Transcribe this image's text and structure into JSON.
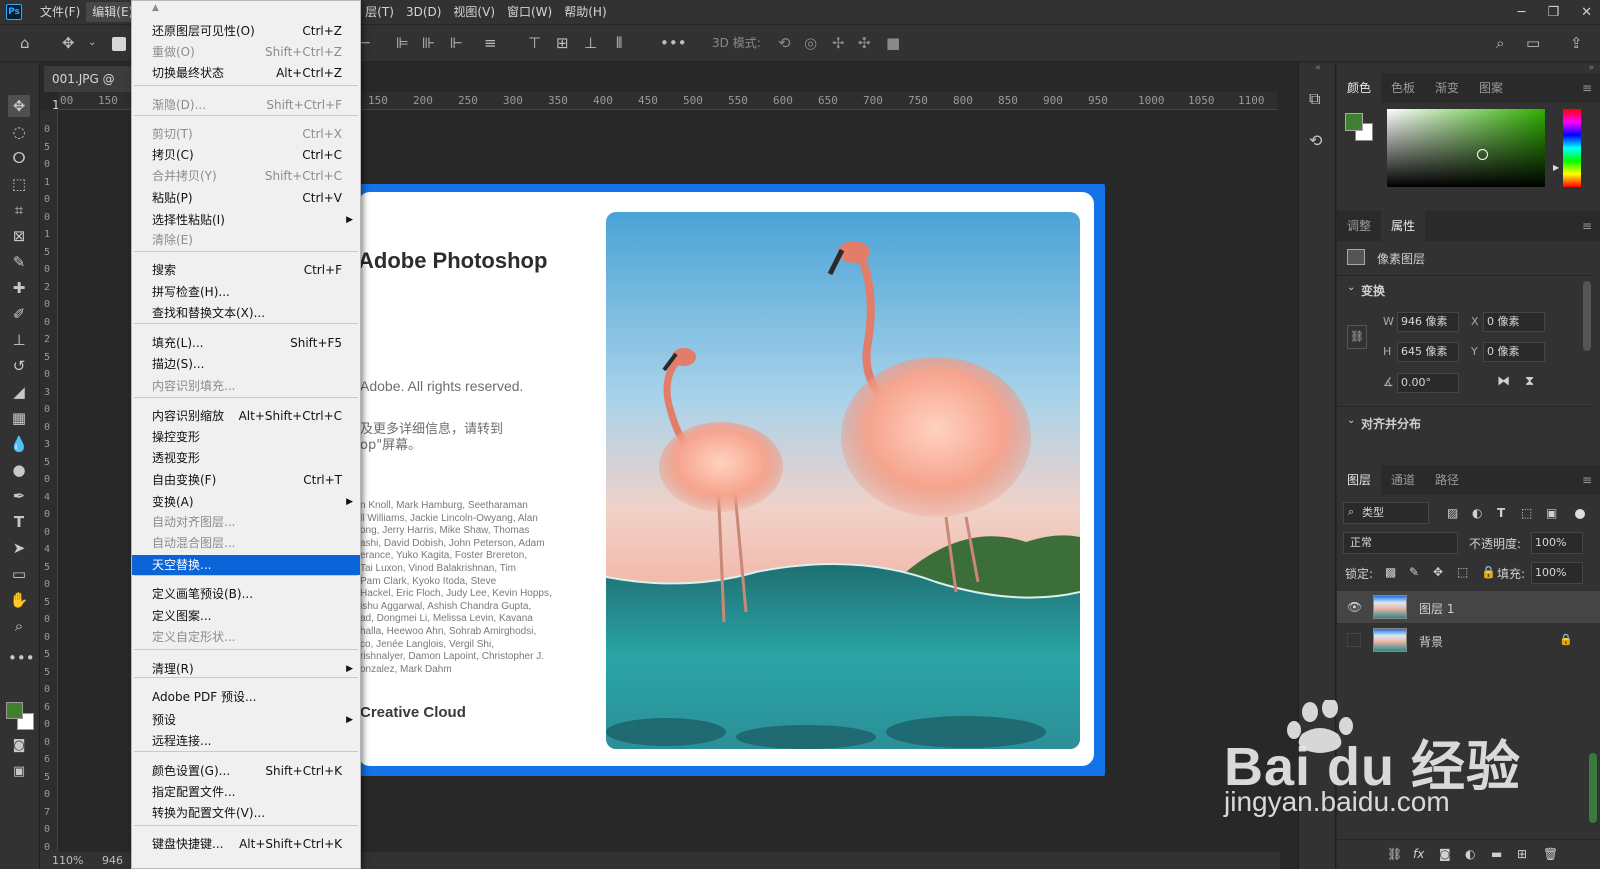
{
  "menubar": {
    "logo": "Ps",
    "items": [
      "文件(F)",
      "编辑(E)",
      "",
      "",
      "",
      "层(T)",
      "3D(D)",
      "视图(V)",
      "窗口(W)",
      "帮助(H)"
    ],
    "active_index": 1
  },
  "options_bar": {
    "mode_label": "3D 模式:"
  },
  "document": {
    "tab_title": "001.JPG @ 110",
    "zoom": "110%",
    "size_fragment": "946",
    "ruler_top": [
      "00",
      "150",
      "150",
      "200",
      "250",
      "300",
      "350",
      "400",
      "450",
      "500",
      "550",
      "600",
      "650",
      "700",
      "750",
      "800",
      "850",
      "900",
      "950",
      "1000",
      "1050",
      "1100"
    ],
    "ruler_left": [
      "0",
      "5",
      "0",
      "1",
      "0",
      "0",
      "1",
      "5",
      "0",
      "2",
      "0",
      "0",
      "2",
      "5",
      "0",
      "3",
      "0",
      "0",
      "3",
      "5",
      "0",
      "4",
      "0",
      "0",
      "4",
      "5",
      "0",
      "5",
      "0",
      "0",
      "5",
      "5",
      "0",
      "6",
      "0",
      "0",
      "6",
      "5",
      "0",
      "7",
      "0",
      "0"
    ]
  },
  "splash": {
    "title": "Adobe Photoshop",
    "copyright": "Adobe. All rights reserved.",
    "more_info_1": "及更多详细信息，请转到",
    "more_info_2": "op\"屏幕。",
    "credits": [
      "n Knoll, Mark Hamburg, Seetharaman",
      "ll Williams, Jackie Lincoln-Owyang, Alan",
      "ong, Jerry Harris, Mike Shaw, Thomas",
      "ashi, David Dobish, John Peterson, Adam",
      "erance, Yuko Kagita, Foster Brereton,",
      "Tai Luxon, Vinod Balakrishnan, Tim",
      "Pam Clark, Kyoko Itoda, Steve",
      "Hackel, Eric Floch, Judy Lee, Kevin Hopps,",
      "ishu Aggarwal, Ashish Chandra Gupta,",
      "ad, Dongmei Li, Melissa Levin, Kavana",
      "halla, Heewoo Ahn, Sohrab Amirghodsi,",
      "co, Jenée Langlois, Vergil Shi,",
      "rishnalyer, Damon Lapoint, Christopher J.",
      "onzalez, Mark Dahm"
    ],
    "footer": "Creative Cloud"
  },
  "edit_menu": {
    "items": [
      {
        "label": "还原图层可见性(O)",
        "shortcut": "Ctrl+Z",
        "disabled": false
      },
      {
        "label": "重做(O)",
        "shortcut": "Shift+Ctrl+Z",
        "disabled": true
      },
      {
        "label": "切换最终状态",
        "shortcut": "Alt+Ctrl+Z",
        "disabled": false
      },
      {
        "label": "渐隐(D)...",
        "shortcut": "Shift+Ctrl+F",
        "disabled": true
      },
      {
        "label": "剪切(T)",
        "shortcut": "Ctrl+X",
        "disabled": true
      },
      {
        "label": "拷贝(C)",
        "shortcut": "Ctrl+C",
        "disabled": false
      },
      {
        "label": "合并拷贝(Y)",
        "shortcut": "Shift+Ctrl+C",
        "disabled": true
      },
      {
        "label": "粘贴(P)",
        "shortcut": "Ctrl+V",
        "disabled": false
      },
      {
        "label": "选择性粘贴(I)",
        "shortcut": "",
        "disabled": false
      },
      {
        "label": "清除(E)",
        "shortcut": "",
        "disabled": true
      },
      {
        "label": "搜索",
        "shortcut": "Ctrl+F",
        "disabled": false
      },
      {
        "label": "拼写检查(H)...",
        "shortcut": "",
        "disabled": false
      },
      {
        "label": "查找和替换文本(X)...",
        "shortcut": "",
        "disabled": false
      },
      {
        "label": "填充(L)...",
        "shortcut": "Shift+F5",
        "disabled": false
      },
      {
        "label": "描边(S)...",
        "shortcut": "",
        "disabled": false
      },
      {
        "label": "内容识别填充...",
        "shortcut": "",
        "disabled": true
      },
      {
        "label": "内容识别缩放",
        "shortcut": "Alt+Shift+Ctrl+C",
        "disabled": false
      },
      {
        "label": "操控变形",
        "shortcut": "",
        "disabled": false
      },
      {
        "label": "透视变形",
        "shortcut": "",
        "disabled": false
      },
      {
        "label": "自由变换(F)",
        "shortcut": "Ctrl+T",
        "disabled": false
      },
      {
        "label": "变换(A)",
        "shortcut": "",
        "disabled": false
      },
      {
        "label": "自动对齐图层...",
        "shortcut": "",
        "disabled": true
      },
      {
        "label": "自动混合图层...",
        "shortcut": "",
        "disabled": true
      },
      {
        "label": "天空替换...",
        "shortcut": "",
        "disabled": false
      },
      {
        "label": "定义画笔预设(B)...",
        "shortcut": "",
        "disabled": false
      },
      {
        "label": "定义图案...",
        "shortcut": "",
        "disabled": false
      },
      {
        "label": "定义自定形状...",
        "shortcut": "",
        "disabled": true
      },
      {
        "label": "清理(R)",
        "shortcut": "",
        "disabled": false
      },
      {
        "label": "Adobe PDF 预设...",
        "shortcut": "",
        "disabled": false
      },
      {
        "label": "预设",
        "shortcut": "",
        "disabled": false
      },
      {
        "label": "远程连接...",
        "shortcut": "",
        "disabled": false
      },
      {
        "label": "颜色设置(G)...",
        "shortcut": "Shift+Ctrl+K",
        "disabled": false
      },
      {
        "label": "指定配置文件...",
        "shortcut": "",
        "disabled": false
      },
      {
        "label": "转换为配置文件(V)...",
        "shortcut": "",
        "disabled": false
      },
      {
        "label": "键盘快捷键...",
        "shortcut": "Alt+Shift+Ctrl+K",
        "disabled": false
      }
    ],
    "highlighted": "天空替换..."
  },
  "color_panel": {
    "tabs": [
      "颜色",
      "色板",
      "渐变",
      "图案"
    ],
    "foreground": "#3f7f2e",
    "background": "#ffffff"
  },
  "properties_panel": {
    "tabs": [
      "调整",
      "属性"
    ],
    "layer_kind": "像素图层",
    "transform_title": "变换",
    "w_label": "W",
    "w_value": "946 像素",
    "h_label": "H",
    "h_value": "645 像素",
    "x_label": "X",
    "x_value": "0 像素",
    "y_label": "Y",
    "y_value": "0 像素",
    "angle": "0.00°",
    "align_title": "对齐并分布"
  },
  "layers_panel": {
    "tabs": [
      "图层",
      "通道",
      "路径"
    ],
    "filter": "类型",
    "blend_mode": "正常",
    "opacity_label": "不透明度:",
    "opacity_value": "100%",
    "lock_label": "锁定:",
    "fill_label": "填充:",
    "fill_value": "100%",
    "layers": [
      {
        "name": "图层 1",
        "visible": true,
        "selected": true
      },
      {
        "name": "背景",
        "visible": false,
        "selected": false
      }
    ]
  },
  "watermark": {
    "brand": "Bai du 经验",
    "url": "jingyan.baidu.com"
  },
  "colors": {
    "highlight": "#0a64d8",
    "splash_border": "#1473e6"
  }
}
